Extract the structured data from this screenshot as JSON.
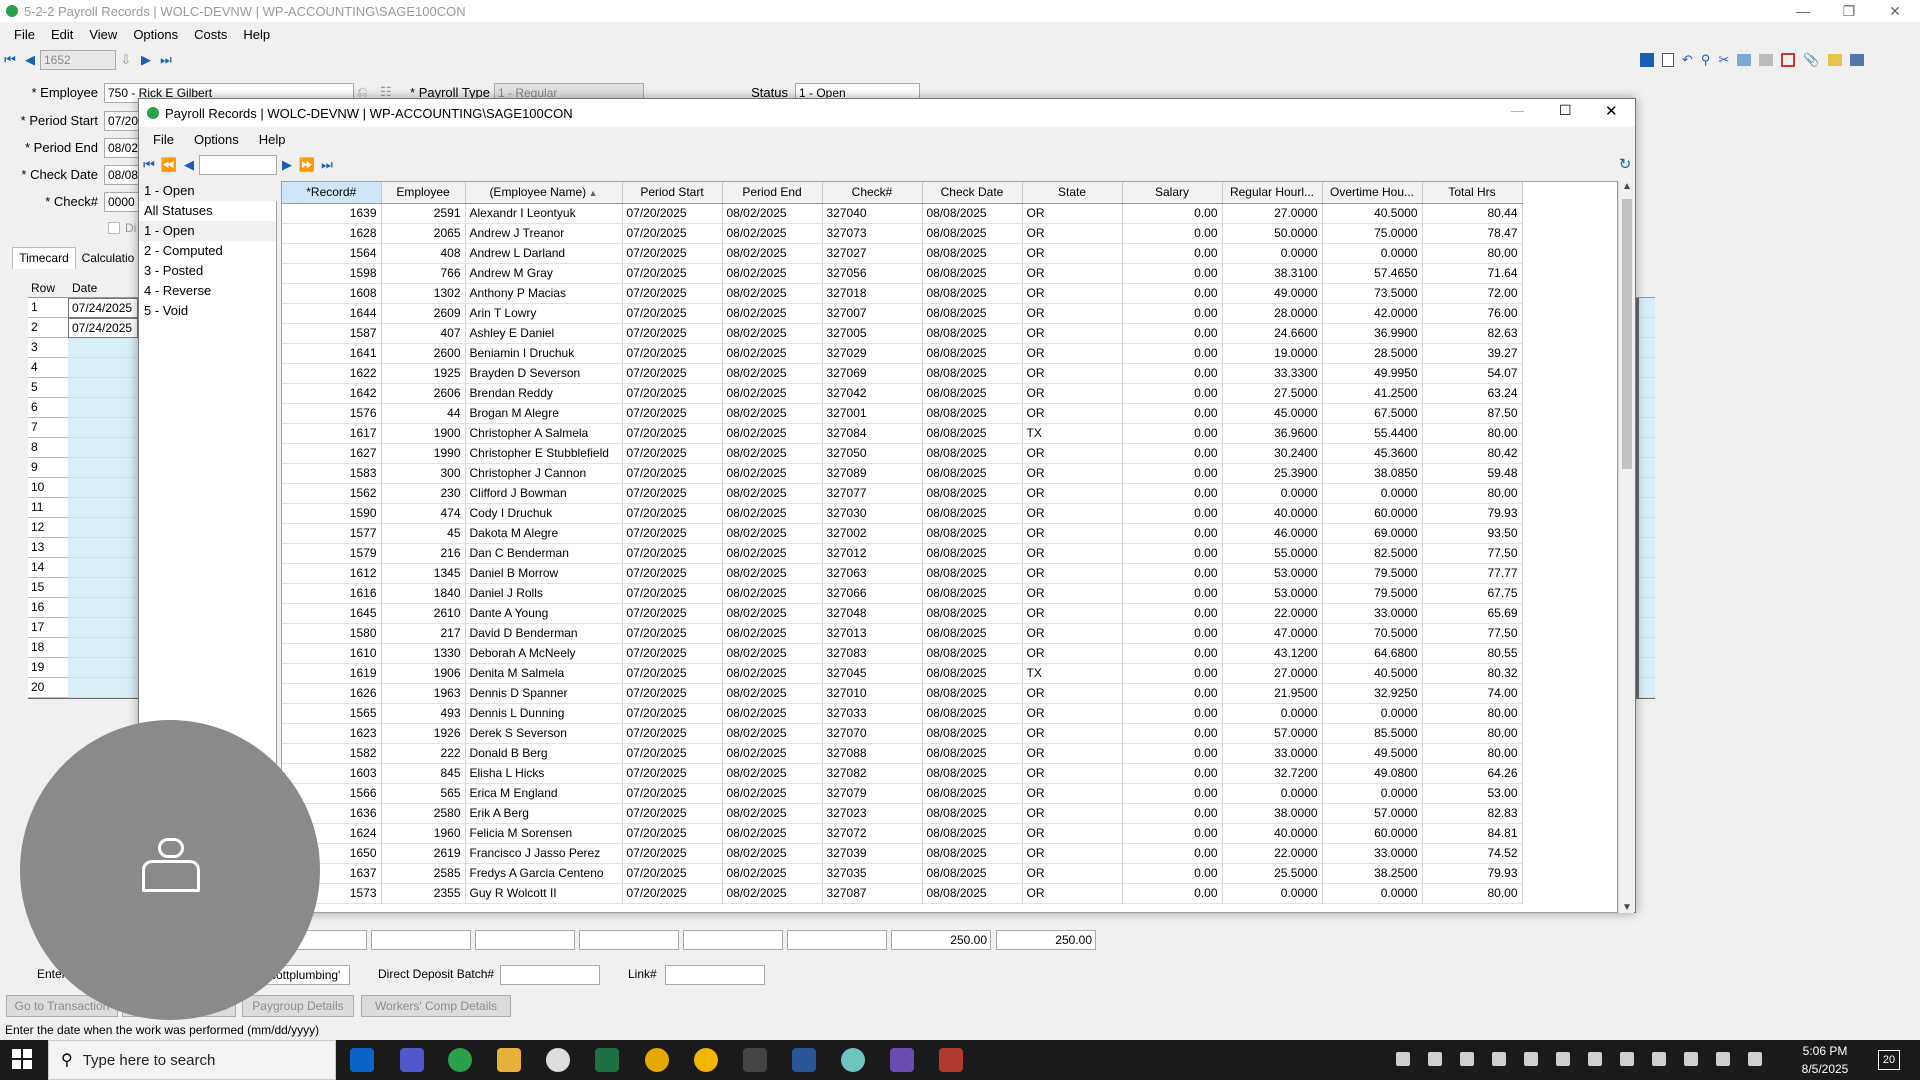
{
  "app": {
    "title": "5-2-2 Payroll Records | WOLC-DEVNW | WP-ACCOUNTING\\SAGE100CON",
    "record_input": "1652"
  },
  "menu": [
    "File",
    "Edit",
    "View",
    "Options",
    "Costs",
    "Help"
  ],
  "form": {
    "employee_label": "* Employee",
    "employee_value": "750 - Rick E Gilbert",
    "payroll_type_label": "* Payroll Type",
    "payroll_type_value": "1 - Regular",
    "status_label": "Status",
    "status_value": "1 - Open",
    "period_start_label": "* Period Start",
    "period_start_value": "07/20",
    "period_end_label": "* Period End",
    "period_end_value": "08/02",
    "check_date_label": "* Check Date",
    "check_date_value": "08/08",
    "check_label": "* Check#",
    "check_value": "0000",
    "checkbox_label": "Di"
  },
  "tabs": [
    "Timecard",
    "Calculatio"
  ],
  "timecard": {
    "headers": [
      "Row",
      "Date"
    ],
    "rows": [
      {
        "row": "1",
        "date": "07/24/2025"
      },
      {
        "row": "2",
        "date": "07/24/2025"
      },
      {
        "row": "3",
        "date": ""
      },
      {
        "row": "4",
        "date": ""
      },
      {
        "row": "5",
        "date": ""
      },
      {
        "row": "6",
        "date": ""
      },
      {
        "row": "7",
        "date": ""
      },
      {
        "row": "8",
        "date": ""
      },
      {
        "row": "9",
        "date": ""
      },
      {
        "row": "10",
        "date": ""
      },
      {
        "row": "11",
        "date": ""
      },
      {
        "row": "12",
        "date": ""
      },
      {
        "row": "13",
        "date": ""
      },
      {
        "row": "14",
        "date": ""
      },
      {
        "row": "15",
        "date": ""
      },
      {
        "row": "16",
        "date": ""
      },
      {
        "row": "17",
        "date": ""
      },
      {
        "row": "18",
        "date": ""
      },
      {
        "row": "19",
        "date": ""
      },
      {
        "row": "20",
        "date": ""
      }
    ],
    "total1": "250.00",
    "total2": "250.00"
  },
  "bottom": {
    "enter_label": "Enter",
    "account_value": "cottplumbing'",
    "dd_label": "Direct Deposit Batch#",
    "dd_value": "",
    "link_label": "Link#",
    "link_value": "",
    "buttons": [
      "Go to Transaction",
      "Paygroup Details",
      "Workers' Comp Details"
    ]
  },
  "statusbar": "Enter the date when the work was performed (mm/dd/yyyy)",
  "modal": {
    "title": "Payroll Records | WOLC-DEVNW | WP-ACCOUNTING\\SAGE100CON",
    "menu": [
      "File",
      "Options",
      "Help"
    ],
    "filter_selected": "1 - Open",
    "statuses": [
      "All Statuses",
      "1 - Open",
      "2 - Computed",
      "3 - Posted",
      "4 - Reverse",
      "5 - Void"
    ],
    "columns": [
      "*Record#",
      "Employee",
      "(Employee Name)",
      "Period Start",
      "Period End",
      "Check#",
      "Check Date",
      "State",
      "Salary",
      "Regular Hourl...",
      "Overtime Hou...",
      "Total Hrs"
    ],
    "rows": [
      [
        "1639",
        "2591",
        "Alexandr I Leontyuk",
        "07/20/2025",
        "08/02/2025",
        "327040",
        "08/08/2025",
        "OR",
        "0.00",
        "27.0000",
        "40.5000",
        "80.44"
      ],
      [
        "1628",
        "2065",
        "Andrew J Treanor",
        "07/20/2025",
        "08/02/2025",
        "327073",
        "08/08/2025",
        "OR",
        "0.00",
        "50.0000",
        "75.0000",
        "78.47"
      ],
      [
        "1564",
        "408",
        "Andrew L Darland",
        "07/20/2025",
        "08/02/2025",
        "327027",
        "08/08/2025",
        "OR",
        "0.00",
        "0.0000",
        "0.0000",
        "80.00"
      ],
      [
        "1598",
        "766",
        "Andrew M Gray",
        "07/20/2025",
        "08/02/2025",
        "327056",
        "08/08/2025",
        "OR",
        "0.00",
        "38.3100",
        "57.4650",
        "71.64"
      ],
      [
        "1608",
        "1302",
        "Anthony P Macias",
        "07/20/2025",
        "08/02/2025",
        "327018",
        "08/08/2025",
        "OR",
        "0.00",
        "49.0000",
        "73.5000",
        "72.00"
      ],
      [
        "1644",
        "2609",
        "Arin T Lowry",
        "07/20/2025",
        "08/02/2025",
        "327007",
        "08/08/2025",
        "OR",
        "0.00",
        "28.0000",
        "42.0000",
        "76.00"
      ],
      [
        "1587",
        "407",
        "Ashley E Daniel",
        "07/20/2025",
        "08/02/2025",
        "327005",
        "08/08/2025",
        "OR",
        "0.00",
        "24.6600",
        "36.9900",
        "82.63"
      ],
      [
        "1641",
        "2600",
        "Beniamin I Druchuk",
        "07/20/2025",
        "08/02/2025",
        "327029",
        "08/08/2025",
        "OR",
        "0.00",
        "19.0000",
        "28.5000",
        "39.27"
      ],
      [
        "1622",
        "1925",
        "Brayden D Severson",
        "07/20/2025",
        "08/02/2025",
        "327069",
        "08/08/2025",
        "OR",
        "0.00",
        "33.3300",
        "49.9950",
        "54.07"
      ],
      [
        "1642",
        "2606",
        "Brendan Reddy",
        "07/20/2025",
        "08/02/2025",
        "327042",
        "08/08/2025",
        "OR",
        "0.00",
        "27.5000",
        "41.2500",
        "63.24"
      ],
      [
        "1576",
        "44",
        "Brogan M Alegre",
        "07/20/2025",
        "08/02/2025",
        "327001",
        "08/08/2025",
        "OR",
        "0.00",
        "45.0000",
        "67.5000",
        "87.50"
      ],
      [
        "1617",
        "1900",
        "Christopher A Salmela",
        "07/20/2025",
        "08/02/2025",
        "327084",
        "08/08/2025",
        "TX",
        "0.00",
        "36.9600",
        "55.4400",
        "80.00"
      ],
      [
        "1627",
        "1990",
        "Christopher E Stubblefield",
        "07/20/2025",
        "08/02/2025",
        "327050",
        "08/08/2025",
        "OR",
        "0.00",
        "30.2400",
        "45.3600",
        "80.42"
      ],
      [
        "1583",
        "300",
        "Christopher J Cannon",
        "07/20/2025",
        "08/02/2025",
        "327089",
        "08/08/2025",
        "OR",
        "0.00",
        "25.3900",
        "38.0850",
        "59.48"
      ],
      [
        "1562",
        "230",
        "Clifford J Bowman",
        "07/20/2025",
        "08/02/2025",
        "327077",
        "08/08/2025",
        "OR",
        "0.00",
        "0.0000",
        "0.0000",
        "80.00"
      ],
      [
        "1590",
        "474",
        "Cody I Druchuk",
        "07/20/2025",
        "08/02/2025",
        "327030",
        "08/08/2025",
        "OR",
        "0.00",
        "40.0000",
        "60.0000",
        "79.93"
      ],
      [
        "1577",
        "45",
        "Dakota M Alegre",
        "07/20/2025",
        "08/02/2025",
        "327002",
        "08/08/2025",
        "OR",
        "0.00",
        "46.0000",
        "69.0000",
        "93.50"
      ],
      [
        "1579",
        "216",
        "Dan C Benderman",
        "07/20/2025",
        "08/02/2025",
        "327012",
        "08/08/2025",
        "OR",
        "0.00",
        "55.0000",
        "82.5000",
        "77.50"
      ],
      [
        "1612",
        "1345",
        "Daniel B Morrow",
        "07/20/2025",
        "08/02/2025",
        "327063",
        "08/08/2025",
        "OR",
        "0.00",
        "53.0000",
        "79.5000",
        "77.77"
      ],
      [
        "1616",
        "1840",
        "Daniel J Rolls",
        "07/20/2025",
        "08/02/2025",
        "327066",
        "08/08/2025",
        "OR",
        "0.00",
        "53.0000",
        "79.5000",
        "67.75"
      ],
      [
        "1645",
        "2610",
        "Dante A Young",
        "07/20/2025",
        "08/02/2025",
        "327048",
        "08/08/2025",
        "OR",
        "0.00",
        "22.0000",
        "33.0000",
        "65.69"
      ],
      [
        "1580",
        "217",
        "David D Benderman",
        "07/20/2025",
        "08/02/2025",
        "327013",
        "08/08/2025",
        "OR",
        "0.00",
        "47.0000",
        "70.5000",
        "77.50"
      ],
      [
        "1610",
        "1330",
        "Deborah A McNeely",
        "07/20/2025",
        "08/02/2025",
        "327083",
        "08/08/2025",
        "OR",
        "0.00",
        "43.1200",
        "64.6800",
        "80.55"
      ],
      [
        "1619",
        "1906",
        "Denita M Salmela",
        "07/20/2025",
        "08/02/2025",
        "327045",
        "08/08/2025",
        "TX",
        "0.00",
        "27.0000",
        "40.5000",
        "80.32"
      ],
      [
        "1626",
        "1963",
        "Dennis D Spanner",
        "07/20/2025",
        "08/02/2025",
        "327010",
        "08/08/2025",
        "OR",
        "0.00",
        "21.9500",
        "32.9250",
        "74.00"
      ],
      [
        "1565",
        "493",
        "Dennis L Dunning",
        "07/20/2025",
        "08/02/2025",
        "327033",
        "08/08/2025",
        "OR",
        "0.00",
        "0.0000",
        "0.0000",
        "80.00"
      ],
      [
        "1623",
        "1926",
        "Derek S Severson",
        "07/20/2025",
        "08/02/2025",
        "327070",
        "08/08/2025",
        "OR",
        "0.00",
        "57.0000",
        "85.5000",
        "80.00"
      ],
      [
        "1582",
        "222",
        "Donald B Berg",
        "07/20/2025",
        "08/02/2025",
        "327088",
        "08/08/2025",
        "OR",
        "0.00",
        "33.0000",
        "49.5000",
        "80.00"
      ],
      [
        "1603",
        "845",
        "Elisha L Hicks",
        "07/20/2025",
        "08/02/2025",
        "327082",
        "08/08/2025",
        "OR",
        "0.00",
        "32.7200",
        "49.0800",
        "64.26"
      ],
      [
        "1566",
        "565",
        "Erica M England",
        "07/20/2025",
        "08/02/2025",
        "327079",
        "08/08/2025",
        "OR",
        "0.00",
        "0.0000",
        "0.0000",
        "53.00"
      ],
      [
        "1636",
        "2580",
        "Erik A Berg",
        "07/20/2025",
        "08/02/2025",
        "327023",
        "08/08/2025",
        "OR",
        "0.00",
        "38.0000",
        "57.0000",
        "82.83"
      ],
      [
        "1624",
        "1960",
        "Felicia M Sorensen",
        "07/20/2025",
        "08/02/2025",
        "327072",
        "08/08/2025",
        "OR",
        "0.00",
        "40.0000",
        "60.0000",
        "84.81"
      ],
      [
        "1650",
        "2619",
        "Francisco J Jasso Perez",
        "07/20/2025",
        "08/02/2025",
        "327039",
        "08/08/2025",
        "OR",
        "0.00",
        "22.0000",
        "33.0000",
        "74.52"
      ],
      [
        "1637",
        "2585",
        "Fredys A Garcia Centeno",
        "07/20/2025",
        "08/02/2025",
        "327035",
        "08/08/2025",
        "OR",
        "0.00",
        "25.5000",
        "38.2500",
        "79.93"
      ],
      [
        "1573",
        "2355",
        "Guy R Wolcott II",
        "07/20/2025",
        "08/02/2025",
        "327087",
        "08/08/2025",
        "OR",
        "0.00",
        "0.0000",
        "0.0000",
        "80.00"
      ]
    ]
  },
  "taskbar": {
    "search_placeholder": "Type here to search",
    "time": "5:06 PM",
    "date": "8/5/2025",
    "notif": "20"
  },
  "colors": {
    "accent": "#1b5fb0",
    "selected_header": "#cfe6f7",
    "grid_row_tint": "#d9eef6"
  }
}
